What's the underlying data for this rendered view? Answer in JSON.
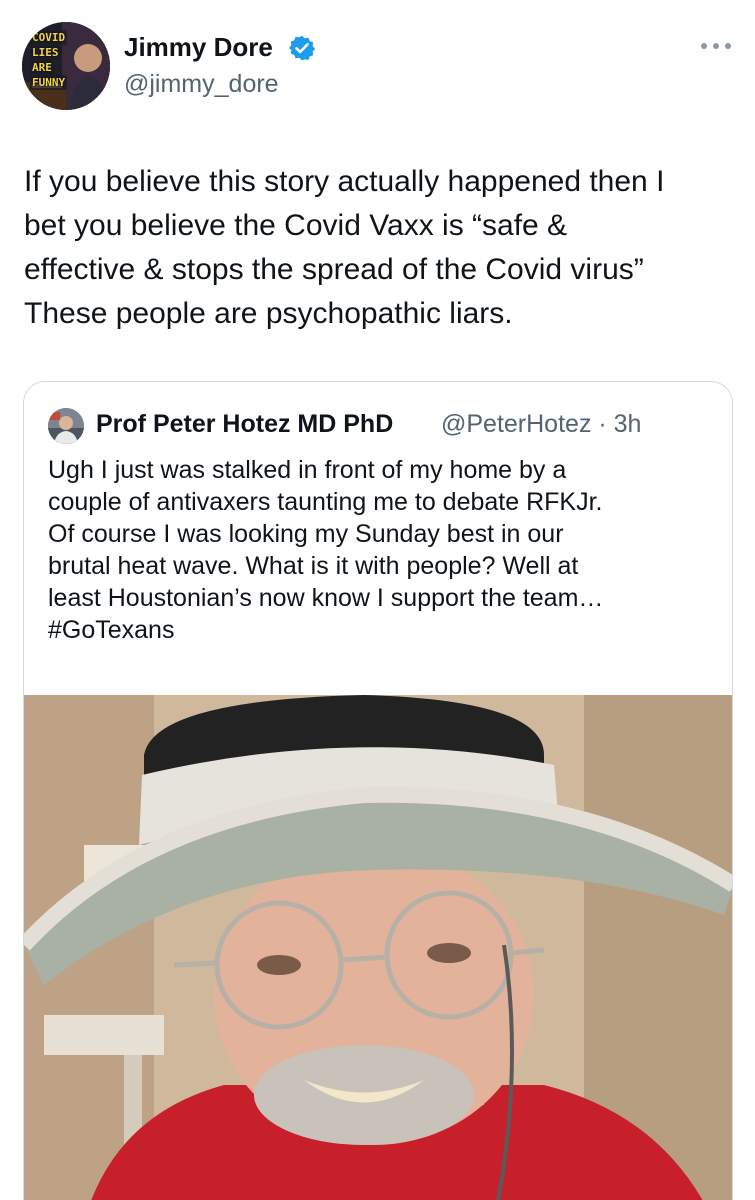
{
  "author": {
    "name": "Jimmy Dore",
    "handle": "@jimmy_dore",
    "avatar_caption": [
      "COVID",
      "LIES",
      "ARE",
      "FUNNY"
    ],
    "verified": true
  },
  "tweet": {
    "lines": [
      "If you believe this story actually happened then I",
      "bet you believe the Covid Vaxx is “safe &",
      "effective & stops the spread of the Covid virus”",
      "These people are psychopathic liars."
    ]
  },
  "quoted": {
    "name": "Prof Peter Hotez MD PhD",
    "handle_time": "@PeterHotez · 3h",
    "lines": [
      "Ugh I just was stalked in front of my home by a",
      "couple of antivaxers taunting me to debate RFKJr.",
      "Of course I was looking my Sunday best in our",
      "brutal heat wave. What is it with people? Well at",
      "least Houstonian’s now know I support the team…",
      "#GoTexans"
    ]
  },
  "icons": {
    "verified": "verified-badge-icon",
    "more": "more-options-icon"
  },
  "colors": {
    "text": "#0f1419",
    "secondary": "#536471",
    "verified": "#1d9bf0",
    "border": "#cfd9de",
    "shirt": "#c8202b",
    "hat": "#a9b1a5"
  }
}
